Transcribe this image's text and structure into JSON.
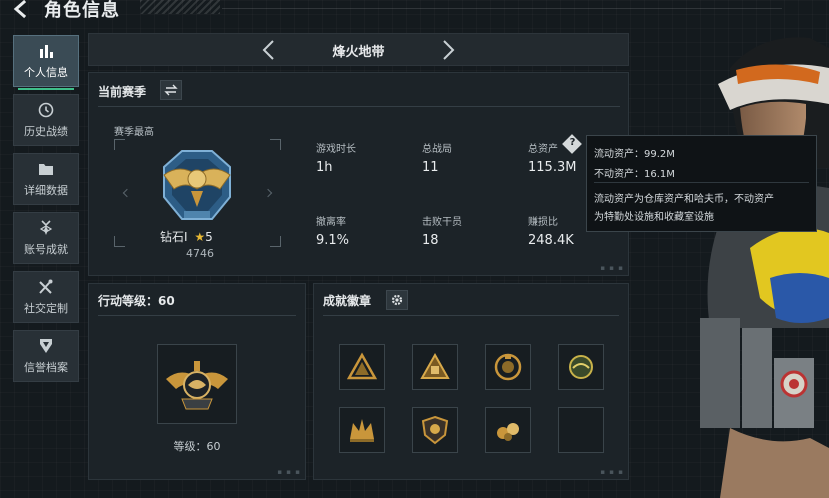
{
  "header": {
    "title": "角色信息",
    "back_icon": "back-arrow-icon"
  },
  "sidebar": {
    "items": [
      {
        "label": "个人信息",
        "icon": "bar-chart-icon",
        "active": true
      },
      {
        "label": "历史战绩",
        "icon": "clock-icon",
        "active": false
      },
      {
        "label": "详细数据",
        "icon": "folder-icon",
        "active": false
      },
      {
        "label": "账号成就",
        "icon": "medal-icon",
        "active": false
      },
      {
        "label": "社交定制",
        "icon": "tools-icon",
        "active": false
      },
      {
        "label": "信誉档案",
        "icon": "badge-icon",
        "active": false
      }
    ]
  },
  "topbar": {
    "title": "烽火地带"
  },
  "season": {
    "title": "当前赛季",
    "peak_label": "赛季最高",
    "rank_name": "钻石Ⅰ",
    "rank_stars": "5",
    "rank_score": "4746",
    "stats": [
      {
        "label": "游戏时长",
        "value": "1h"
      },
      {
        "label": "总战局",
        "value": "11"
      },
      {
        "label": "总资产",
        "value": "115.3M"
      },
      {
        "label": "撤离率",
        "value": "9.1%"
      },
      {
        "label": "击败干员",
        "value": "18"
      },
      {
        "label": "赚损比",
        "value": "248.4K"
      }
    ]
  },
  "tooltip": {
    "liquid": "流动资产：99.2M",
    "fixed": "不动资产：16.1M",
    "desc_line1": "流动资产为仓库资产和哈夫币，不动资产",
    "desc_line2": "为特勤处设施和收藏室设施"
  },
  "action_level": {
    "title": "行动等级：60",
    "level_label": "等级：60"
  },
  "badges": {
    "title": "成就徽章",
    "count_filled": 7,
    "count_total": 8
  },
  "colors": {
    "accent_green": "#3fbf8a",
    "gold": "#c9963b",
    "panel_bg": "#1c2328"
  }
}
